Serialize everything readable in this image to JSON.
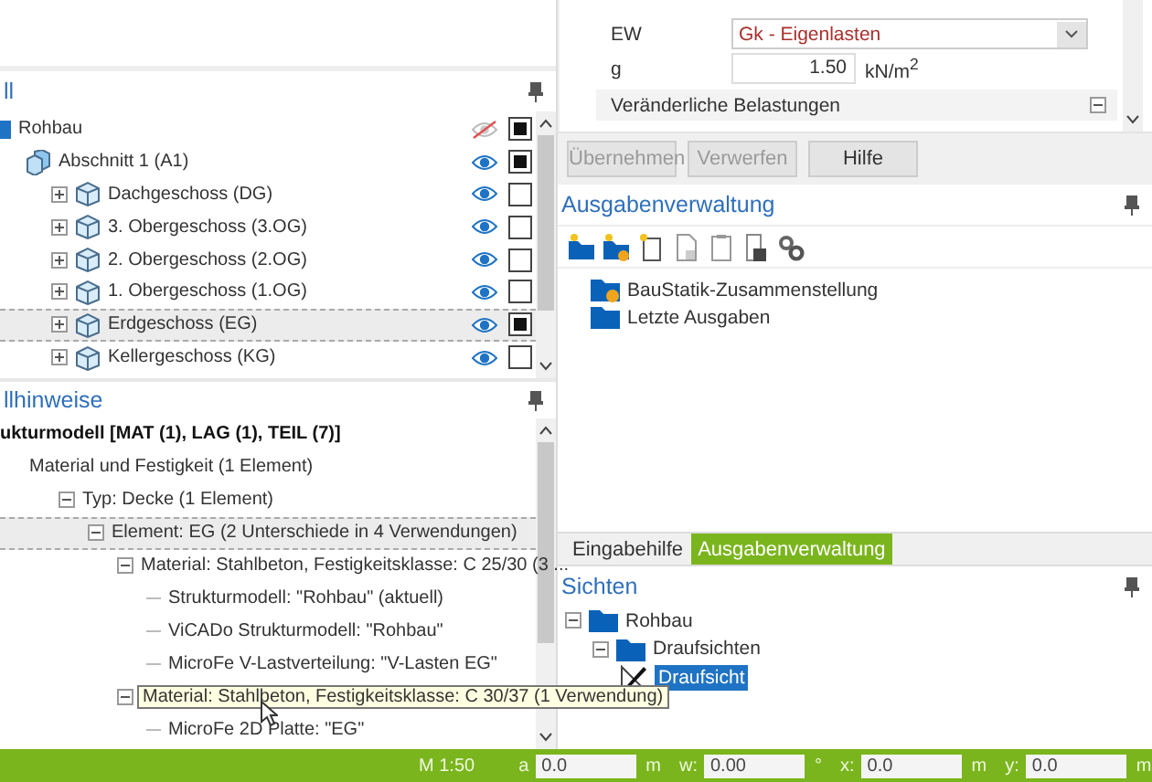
{
  "left": {
    "structure": {
      "title": "ll",
      "tree": [
        {
          "label": "Rohbau",
          "kind": "model",
          "visible": false,
          "checked": true,
          "selected": false,
          "children": [
            {
              "label": "Abschnitt 1 (A1)",
              "kind": "section",
              "visible": true,
              "checked": true,
              "selected": false,
              "children": [
                {
                  "label": "Dachgeschoss (DG)",
                  "kind": "storey",
                  "expanded": false,
                  "visible": true,
                  "checked": false,
                  "selected": false
                },
                {
                  "label": "3. Obergeschoss (3.OG)",
                  "kind": "storey",
                  "expanded": false,
                  "visible": true,
                  "checked": false,
                  "selected": false
                },
                {
                  "label": "2. Obergeschoss (2.OG)",
                  "kind": "storey",
                  "expanded": false,
                  "visible": true,
                  "checked": false,
                  "selected": false
                },
                {
                  "label": "1. Obergeschoss (1.OG)",
                  "kind": "storey",
                  "expanded": false,
                  "visible": true,
                  "checked": false,
                  "selected": false
                },
                {
                  "label": "Erdgeschoss (EG)",
                  "kind": "storey",
                  "expanded": false,
                  "visible": true,
                  "checked": true,
                  "selected": true
                },
                {
                  "label": "Kellergeschoss (KG)",
                  "kind": "storey",
                  "expanded": false,
                  "visible": true,
                  "checked": false,
                  "selected": false
                }
              ]
            }
          ]
        }
      ]
    },
    "notes": {
      "title": "llhinweise",
      "tree": [
        {
          "label": "ukturmodell [MAT (1), LAG (1), TEIL (7)]",
          "bold": true,
          "selected": false,
          "children": [
            {
              "label": "Material und Festigkeit (1 Element)",
              "selected": false,
              "children": [
                {
                  "label": "Typ: Decke (1 Element)",
                  "expanded": true,
                  "selected": false,
                  "children": [
                    {
                      "label": "Element: EG  (2 Unterschiede in 4 Verwendungen)",
                      "expanded": true,
                      "selected": true,
                      "children": [
                        {
                          "label": "Material: Stahlbeton, Festigkeitsklasse: C 25/30 (3 ...",
                          "expanded": true,
                          "selected": false,
                          "children": [
                            {
                              "label": "Strukturmodell: \"Rohbau\" (aktuell)",
                              "selected": false
                            },
                            {
                              "label": "ViCADo Strukturmodell: \"Rohbau\"",
                              "selected": false
                            },
                            {
                              "label": "MicroFe V-Lastverteilung: \"V-Lasten EG\"",
                              "selected": false
                            }
                          ]
                        },
                        {
                          "label": "Material: Stahlbeton, Festigkeitsklasse: C 30/37 (1 Verwendung)",
                          "expanded": true,
                          "tooltip": true,
                          "selected": false,
                          "children": [
                            {
                              "label": "MicroFe 2D Platte: \"EG\"",
                              "selected": false
                            }
                          ]
                        }
                      ]
                    }
                  ]
                }
              ]
            }
          ]
        }
      ]
    }
  },
  "right": {
    "properties": {
      "rows": [
        {
          "kind": "dropdown",
          "label": "EW",
          "value": "Gk - Eigenlasten"
        },
        {
          "kind": "number",
          "label": "g",
          "value": "1.50",
          "unit": "kN/m$^{2}$"
        },
        {
          "kind": "group",
          "label": "Veränderliche Belastungen",
          "expanded": true
        }
      ]
    },
    "buttons": [
      {
        "label": "Übernehmen",
        "disabled": true
      },
      {
        "label": "Verwerfen",
        "disabled": true
      },
      {
        "label": "Hilfe",
        "disabled": false
      }
    ],
    "output": {
      "title": "Ausgabenverwaltung",
      "tree": [
        {
          "label": "BauStatik-Zusammenstellung",
          "kind": "output-folder",
          "selected": false
        },
        {
          "label": "Letzte Ausgaben",
          "kind": "folder",
          "selected": false
        }
      ]
    },
    "tabs": [
      {
        "label": "Eingabehilfe",
        "selected": false
      },
      {
        "label": "Ausgabenverwaltung",
        "selected": true
      }
    ],
    "views": {
      "title": "Sichten",
      "tree": [
        {
          "label": "Rohbau",
          "kind": "folder",
          "expanded": true,
          "selected": false,
          "children": [
            {
              "label": "Draufsichten",
              "kind": "folder",
              "expanded": true,
              "selected": false,
              "children": [
                {
                  "label": "Draufsicht",
                  "kind": "view",
                  "selected": true
                }
              ]
            }
          ]
        }
      ]
    }
  },
  "status_bar": {
    "scale": "M 1:50",
    "fields": [
      {
        "label": "a",
        "value": "0.0",
        "unit": "m"
      },
      {
        "label": "w:",
        "value": "0.00",
        "unit": "°"
      },
      {
        "label": "x:",
        "value": "0.0",
        "unit": "m"
      },
      {
        "label": "y:",
        "value": "0.0",
        "unit": "m"
      }
    ]
  }
}
